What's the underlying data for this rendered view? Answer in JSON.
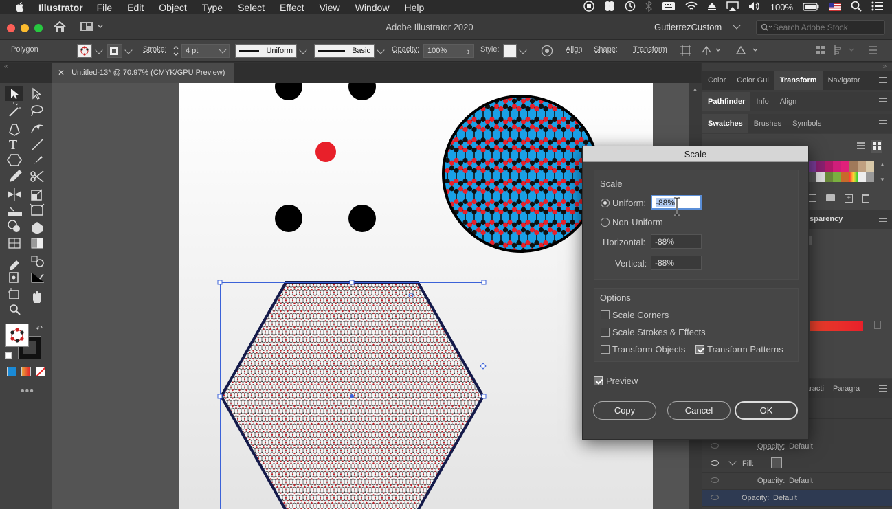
{
  "menubar": {
    "app": "Illustrator",
    "items": [
      "File",
      "Edit",
      "Object",
      "Type",
      "Select",
      "Effect",
      "View",
      "Window",
      "Help"
    ],
    "battery": "100%"
  },
  "titlebar": {
    "title": "Adobe Illustrator 2020",
    "workspace": "GutierrezCustom",
    "search_placeholder": "Search Adobe Stock"
  },
  "control": {
    "object_type": "Polygon",
    "stroke_label": "Stroke:",
    "stroke_value": "4 pt",
    "profile": "Uniform",
    "brush": "Basic",
    "opacity_label": "Opacity:",
    "opacity_value": "100%",
    "style_label": "Style:",
    "align": "Align",
    "shape": "Shape:",
    "transform": "Transform"
  },
  "document_tab": {
    "title": "Untitled-13* @ 70.97% (CMYK/GPU Preview)"
  },
  "panels": {
    "row1": [
      "Color",
      "Color Gui",
      "Transform",
      "Navigator"
    ],
    "row1_active": "Transform",
    "row2": [
      "Pathfinder",
      "Info",
      "Align"
    ],
    "row3": [
      "Swatches",
      "Brushes",
      "Symbols"
    ],
    "transparency": "sparency",
    "row4": [
      "aracti",
      "Paragra"
    ],
    "layers": [
      {
        "label": "Opacity:",
        "value": "Default"
      },
      {
        "label": "Fill:",
        "value": ""
      },
      {
        "label": "Opacity:",
        "value": "Default"
      },
      {
        "label": "Opacity:",
        "value": "Default"
      }
    ]
  },
  "dialog": {
    "title": "Scale",
    "scale_group": "Scale",
    "uniform_label": "Uniform:",
    "uniform_value": "-88%",
    "nonuniform_label": "Non-Uniform",
    "horizontal_label": "Horizontal:",
    "horizontal_value": "-88%",
    "vertical_label": "Vertical:",
    "vertical_value": "-88%",
    "options_group": "Options",
    "scale_corners": "Scale Corners",
    "scale_strokes": "Scale Strokes & Effects",
    "transform_objects": "Transform Objects",
    "transform_patterns": "Transform Patterns",
    "preview": "Preview",
    "copy": "Copy",
    "cancel": "Cancel",
    "ok": "OK"
  },
  "colors": {
    "pattern_blue": "#1aa0e6",
    "dot_red": "#e8202a",
    "selection": "#3b62d8"
  }
}
